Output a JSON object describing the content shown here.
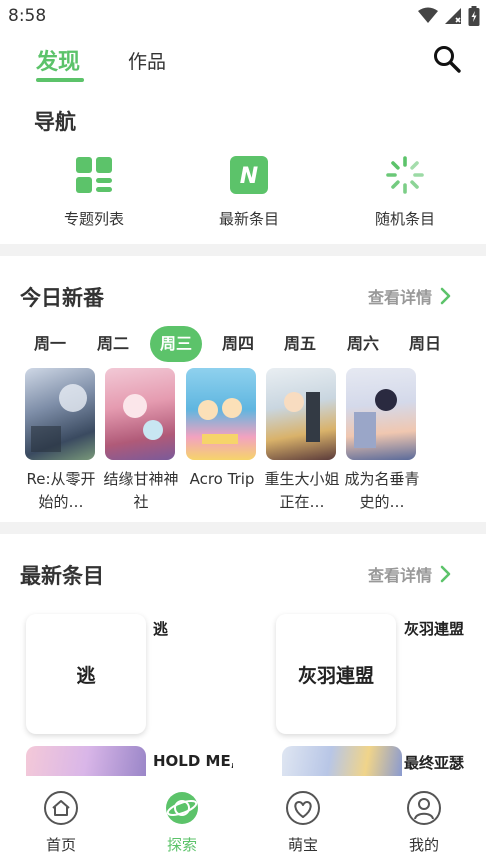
{
  "status_bar": {
    "time": "8:58"
  },
  "top_tabs": [
    {
      "label": "发现",
      "active": true
    },
    {
      "label": "作品",
      "active": false
    }
  ],
  "nav_section": {
    "title": "导航",
    "items": [
      {
        "label": "专题列表",
        "icon": "grid-icon"
      },
      {
        "label": "最新条目",
        "icon": "n-badge-icon"
      },
      {
        "label": "随机条目",
        "icon": "loading-spinner-icon"
      }
    ]
  },
  "today_section": {
    "title": "今日新番",
    "more": "查看详情",
    "days": [
      "周一",
      "周二",
      "周三",
      "周四",
      "周五",
      "周六",
      "周日"
    ],
    "active_day": "周三",
    "anime": [
      {
        "title": "Re:从零开始的…"
      },
      {
        "title": "结缘甘神神社"
      },
      {
        "title": "Acro Trip"
      },
      {
        "title": "重生大小姐正在…"
      },
      {
        "title": "成为名垂青史的…"
      }
    ]
  },
  "latest_section": {
    "title": "最新条目",
    "more": "查看详情",
    "items": [
      {
        "card_text": "逃",
        "name": "逃"
      },
      {
        "card_text": "灰羽連盟",
        "name": "灰羽連盟"
      },
      {
        "name": "HOLD ME,"
      },
      {
        "name": "最终亚瑟"
      }
    ]
  },
  "bottom_nav": [
    {
      "label": "首页",
      "icon": "home-icon",
      "active": false
    },
    {
      "label": "探索",
      "icon": "planet-icon",
      "active": true
    },
    {
      "label": "萌宝",
      "icon": "heart-icon",
      "active": false
    },
    {
      "label": "我的",
      "icon": "user-icon",
      "active": false
    }
  ],
  "colors": {
    "accent": "#5cc36a",
    "divider": "#f2f2f2",
    "muted": "#999999"
  }
}
